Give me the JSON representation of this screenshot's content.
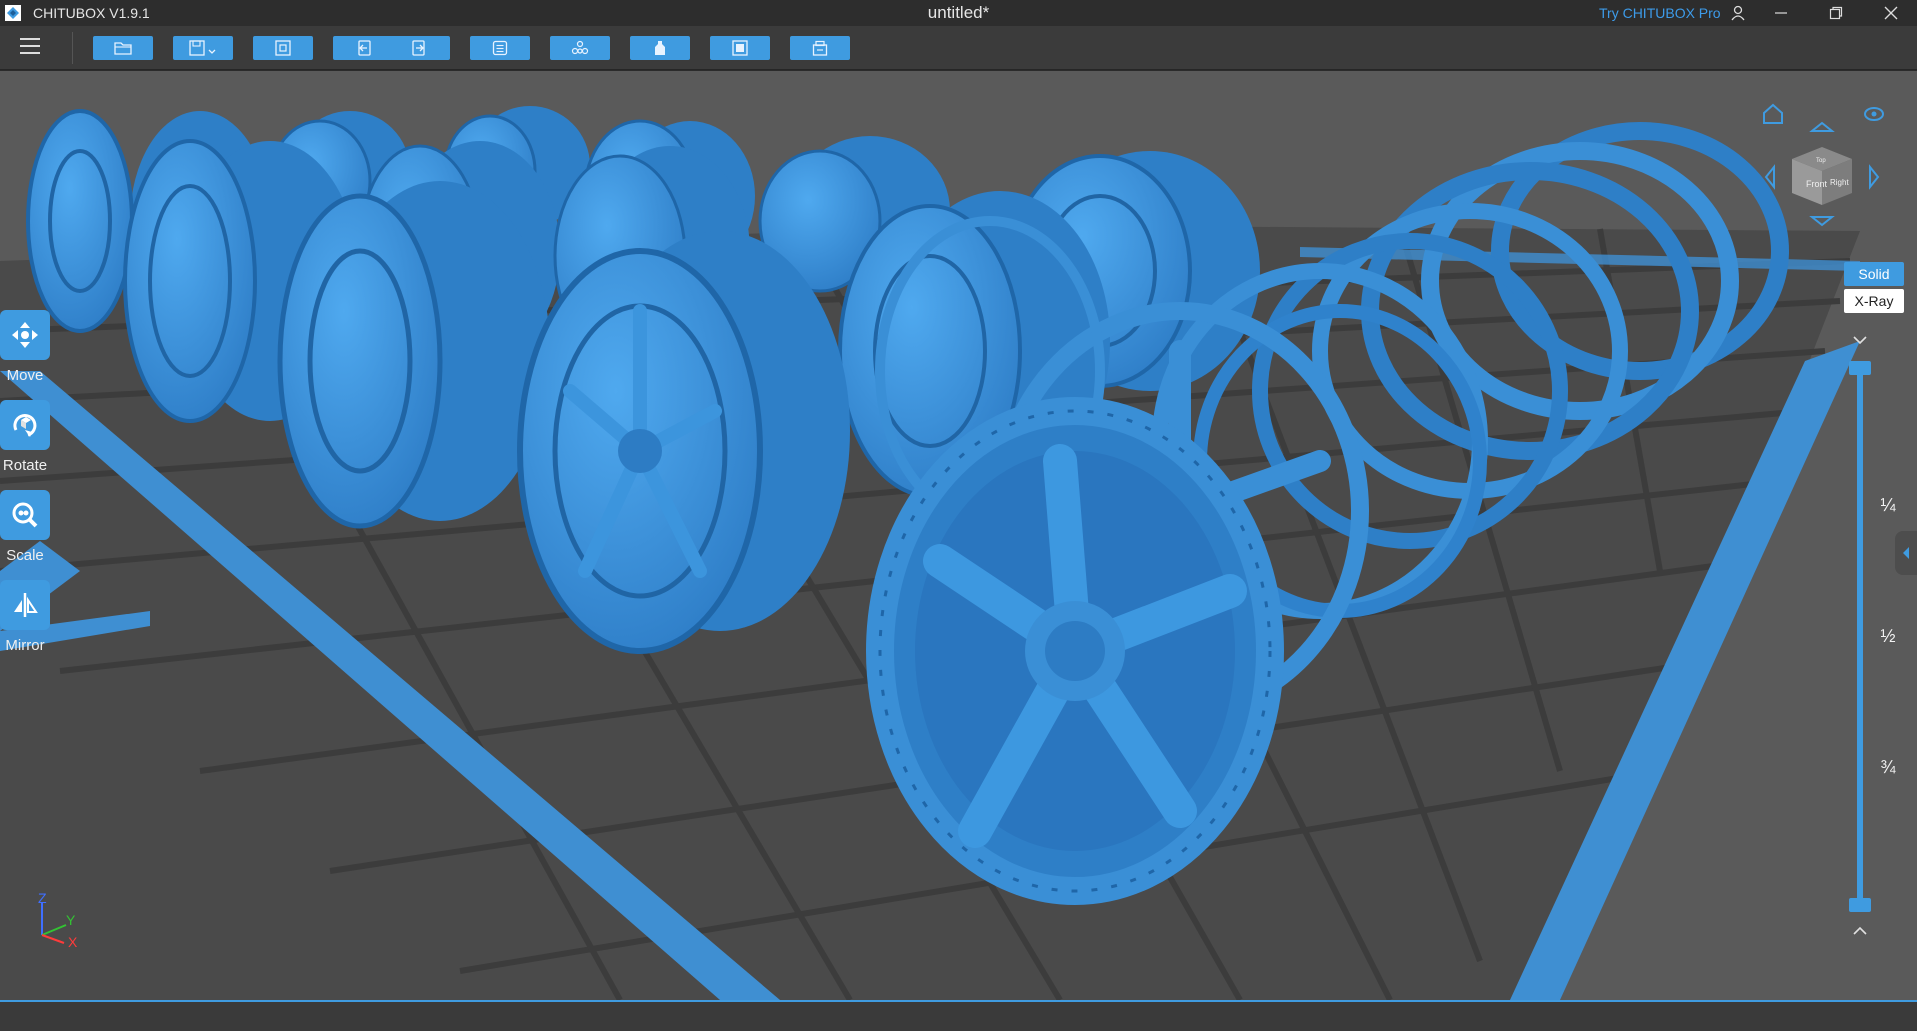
{
  "app": {
    "name": "CHITUBOX V1.9.1",
    "document_title": "untitled*",
    "try_pro": "Try CHITUBOX Pro"
  },
  "toolbar": {
    "buttons": [
      "open-file",
      "save",
      "fit-view",
      "undo",
      "redo",
      "model-list",
      "support",
      "slice-settings",
      "print-settings",
      "settings"
    ]
  },
  "left_tools": [
    {
      "label": "Move",
      "icon": "move-icon"
    },
    {
      "label": "Rotate",
      "icon": "rotate-icon"
    },
    {
      "label": "Scale",
      "icon": "scale-icon"
    },
    {
      "label": "Mirror",
      "icon": "mirror-icon"
    }
  ],
  "view_cube": {
    "front": "Front",
    "right": "Right",
    "top": "Top"
  },
  "render_mode": {
    "solid": "Solid",
    "xray": "X-Ray",
    "active": "Solid"
  },
  "layer_slider": {
    "fractions": [
      "¼",
      "½",
      "¾"
    ]
  },
  "axes": {
    "z": "Z",
    "y": "Y",
    "x": "X"
  },
  "colors": {
    "accent": "#3f9be0",
    "model": "#3a8fd6",
    "background": "#5a5a5a",
    "plate": "#444444"
  }
}
